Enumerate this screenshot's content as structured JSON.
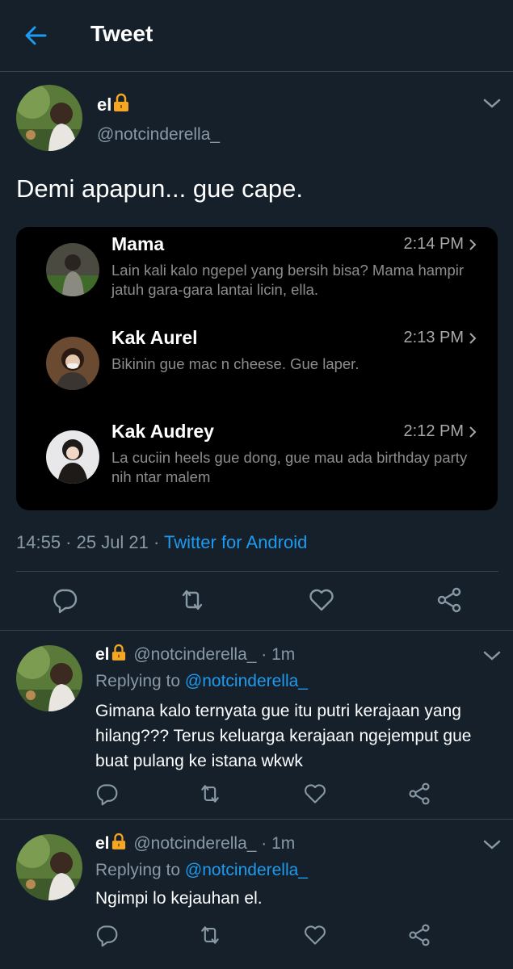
{
  "header": {
    "title": "Tweet"
  },
  "tweet": {
    "author_name": "el",
    "author_handle": "@notcinderella_",
    "text": "Demi apapun... gue cape.",
    "timestamp": "14:55 · 25 Jul 21 · ",
    "source": "Twitter for Android"
  },
  "messages": [
    {
      "sender": "Mama",
      "time": "2:14 PM",
      "preview": "Lain kali kalo ngepel yang bersih bisa? Mama hampir jatuh gara-gara lantai licin, ella."
    },
    {
      "sender": "Kak Aurel",
      "time": "2:13 PM",
      "preview": "Bikinin gue mac n cheese. Gue laper."
    },
    {
      "sender": "Kak Audrey",
      "time": "2:12 PM",
      "preview": "La cuciin heels gue dong, gue mau ada birthday party nih ntar malem"
    }
  ],
  "replies": [
    {
      "author_name": "el",
      "author_handle": "@notcinderella_",
      "time": " · 1m",
      "replying_label": "Replying to ",
      "replying_to": "@notcinderella_",
      "text": "Gimana kalo ternyata gue itu putri kerajaan yang hilang??? Terus keluarga kerajaan ngejemput gue buat pulang ke istana wkwk"
    },
    {
      "author_name": "el",
      "author_handle": "@notcinderella_",
      "time": " · 1m",
      "replying_label": "Replying to ",
      "replying_to": "@notcinderella_",
      "text": "Ngimpi lo kejauhan el."
    }
  ],
  "icons": {
    "back": "arrow-left-icon",
    "lock": "lock-icon",
    "reply": "reply-icon",
    "retweet": "retweet-icon",
    "like": "heart-icon",
    "share": "share-icon",
    "more": "chevron-down-icon"
  },
  "colors": {
    "background": "#15202b",
    "accent": "#1d9bf0",
    "secondary_text": "#8899a6",
    "lock": "#f5a623"
  }
}
